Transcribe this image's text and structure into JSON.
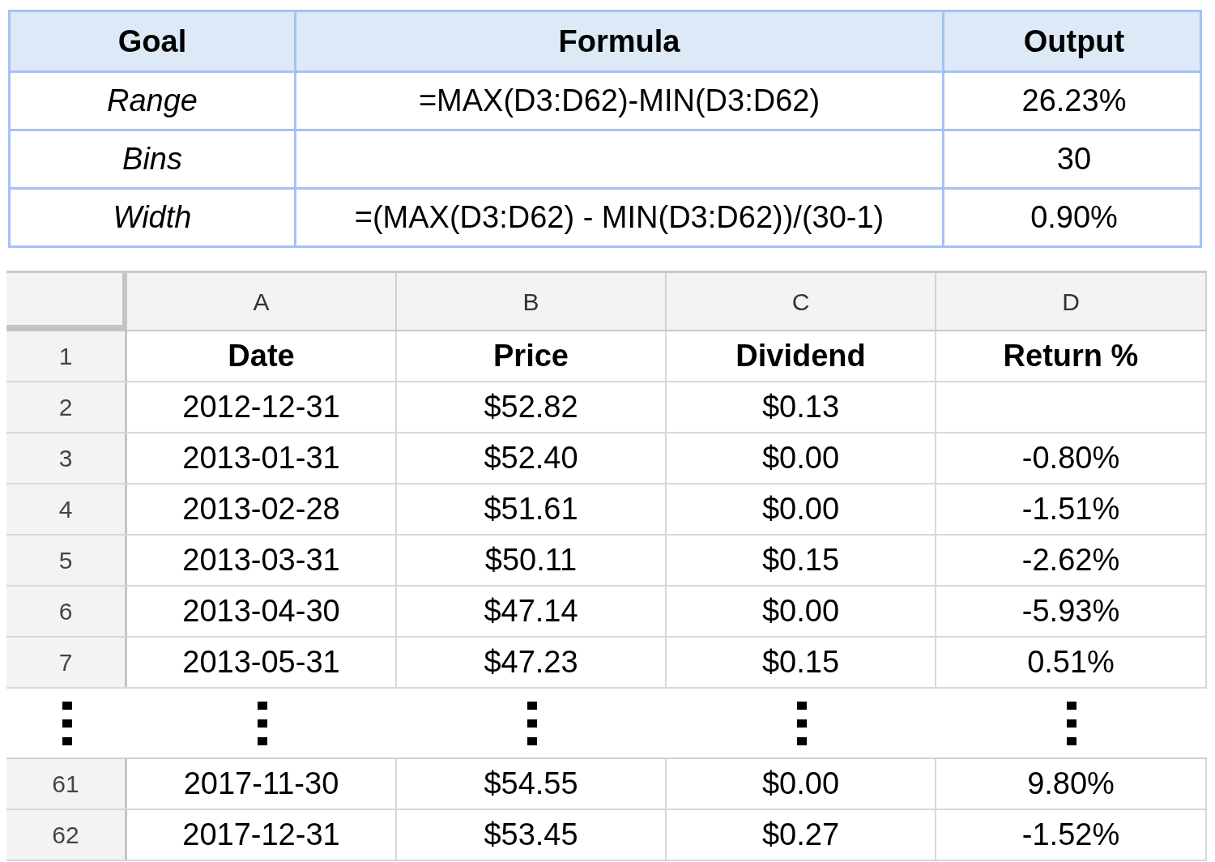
{
  "summary": {
    "columns": [
      "Goal",
      "Formula",
      "Output"
    ],
    "rows": [
      {
        "goal": "Range",
        "formula": "=MAX(D3:D62)-MIN(D3:D62)",
        "output": "26.23%"
      },
      {
        "goal": "Bins",
        "formula": "",
        "output": "30"
      },
      {
        "goal": "Width",
        "formula": "=(MAX(D3:D62) - MIN(D3:D62))/(30-1)",
        "output": "0.90%"
      }
    ]
  },
  "sheet": {
    "columns": [
      "A",
      "B",
      "C",
      "D"
    ],
    "rows": [
      {
        "kind": "header",
        "number": "1",
        "cells": [
          "Date",
          "Price",
          "Dividend",
          "Return %"
        ]
      },
      {
        "kind": "data",
        "number": "2",
        "cells": [
          "2012-12-31",
          "$52.82",
          "$0.13",
          ""
        ]
      },
      {
        "kind": "data",
        "number": "3",
        "cells": [
          "2013-01-31",
          "$52.40",
          "$0.00",
          "-0.80%"
        ]
      },
      {
        "kind": "data",
        "number": "4",
        "cells": [
          "2013-02-28",
          "$51.61",
          "$0.00",
          "-1.51%"
        ]
      },
      {
        "kind": "data",
        "number": "5",
        "cells": [
          "2013-03-31",
          "$50.11",
          "$0.15",
          "-2.62%"
        ]
      },
      {
        "kind": "data",
        "number": "6",
        "cells": [
          "2013-04-30",
          "$47.14",
          "$0.00",
          "-5.93%"
        ]
      },
      {
        "kind": "data",
        "number": "7",
        "cells": [
          "2013-05-31",
          "$47.23",
          "$0.15",
          "0.51%"
        ]
      },
      {
        "kind": "gap"
      },
      {
        "kind": "data",
        "number": "61",
        "cells": [
          "2017-11-30",
          "$54.55",
          "$0.00",
          "9.80%"
        ]
      },
      {
        "kind": "data",
        "number": "62",
        "cells": [
          "2017-12-31",
          "$53.45",
          "$0.27",
          "-1.52%"
        ]
      }
    ]
  }
}
